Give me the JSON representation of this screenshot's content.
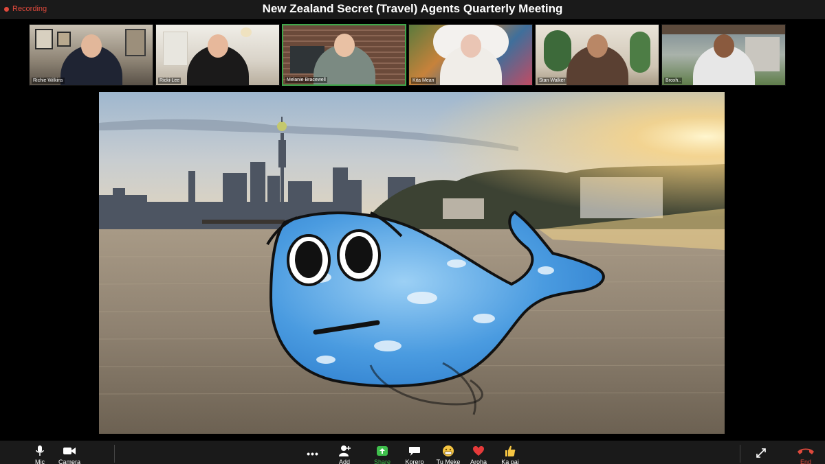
{
  "meeting": {
    "title": "New Zealand Secret (Travel) Agents Quarterly Meeting",
    "recording_label": "Recording"
  },
  "participants": [
    {
      "name": "Richie Wilkins",
      "active": false
    },
    {
      "name": "Ricki-Lee",
      "active": false
    },
    {
      "name": "Melanie Bracewell",
      "active": true
    },
    {
      "name": "Kita Mean",
      "active": false
    },
    {
      "name": "Stan Walker",
      "active": false
    },
    {
      "name": "Broxh..",
      "active": false
    }
  ],
  "toolbar": {
    "mic": "Mic",
    "camera": "Camera",
    "more": "•••",
    "add": "Add",
    "share": "Share",
    "korero": "Korero",
    "tu_meke": "Tu Meke",
    "aroha": "Aroha",
    "ka_pai": "Ka pai",
    "end": "End"
  },
  "colors": {
    "active_border": "#3fa64a",
    "recording": "#e0493c",
    "share": "#3fbf4c",
    "end": "#e0493c"
  }
}
